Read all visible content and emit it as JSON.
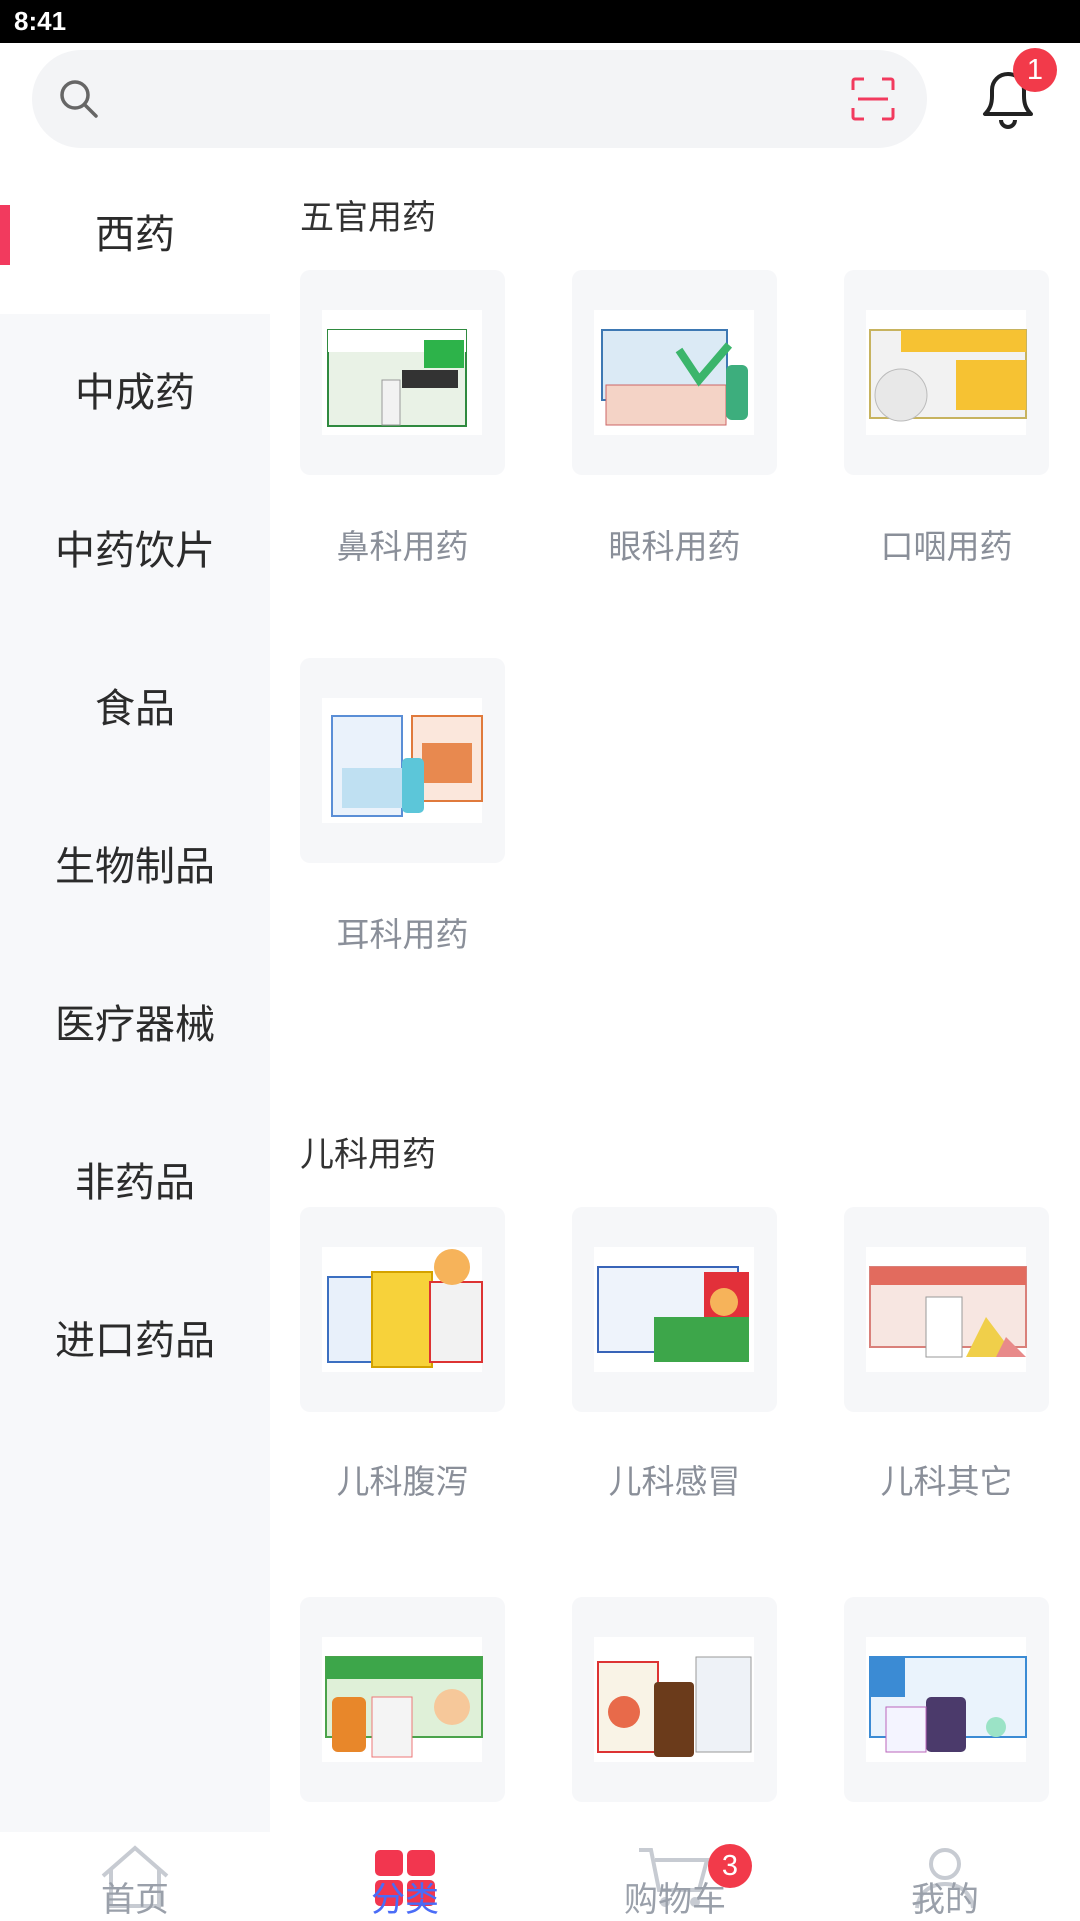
{
  "status_bar": {
    "time": "8:41"
  },
  "header": {
    "notification_count": "1"
  },
  "sidebar": {
    "items": [
      {
        "label": "西药",
        "active": true
      },
      {
        "label": "中成药"
      },
      {
        "label": "中药饮片"
      },
      {
        "label": "食品"
      },
      {
        "label": "生物制品"
      },
      {
        "label": "医疗器械"
      },
      {
        "label": "非药品"
      },
      {
        "label": "进口药品"
      }
    ]
  },
  "main": {
    "sections": [
      {
        "title": "五官用药",
        "items": [
          {
            "label": "鼻科用药"
          },
          {
            "label": "眼科用药"
          },
          {
            "label": "口咽用药"
          },
          {
            "label": "耳科用药"
          }
        ]
      },
      {
        "title": "儿科用药",
        "items": [
          {
            "label": "儿科腹泻"
          },
          {
            "label": "儿科感冒"
          },
          {
            "label": "儿科其它"
          },
          {
            "label": ""
          },
          {
            "label": ""
          },
          {
            "label": ""
          }
        ]
      }
    ]
  },
  "tab_bar": {
    "tabs": [
      {
        "label": "首页",
        "icon": "home-icon"
      },
      {
        "label": "分类",
        "icon": "category-icon",
        "active": true
      },
      {
        "label": "购物车",
        "icon": "cart-icon"
      },
      {
        "label": "我的",
        "icon": "profile-icon"
      }
    ],
    "cart_count": "3"
  },
  "colors": {
    "accent": "#f23a5e",
    "badge": "#f23a4a",
    "active_tab": "#4a6cf7"
  }
}
